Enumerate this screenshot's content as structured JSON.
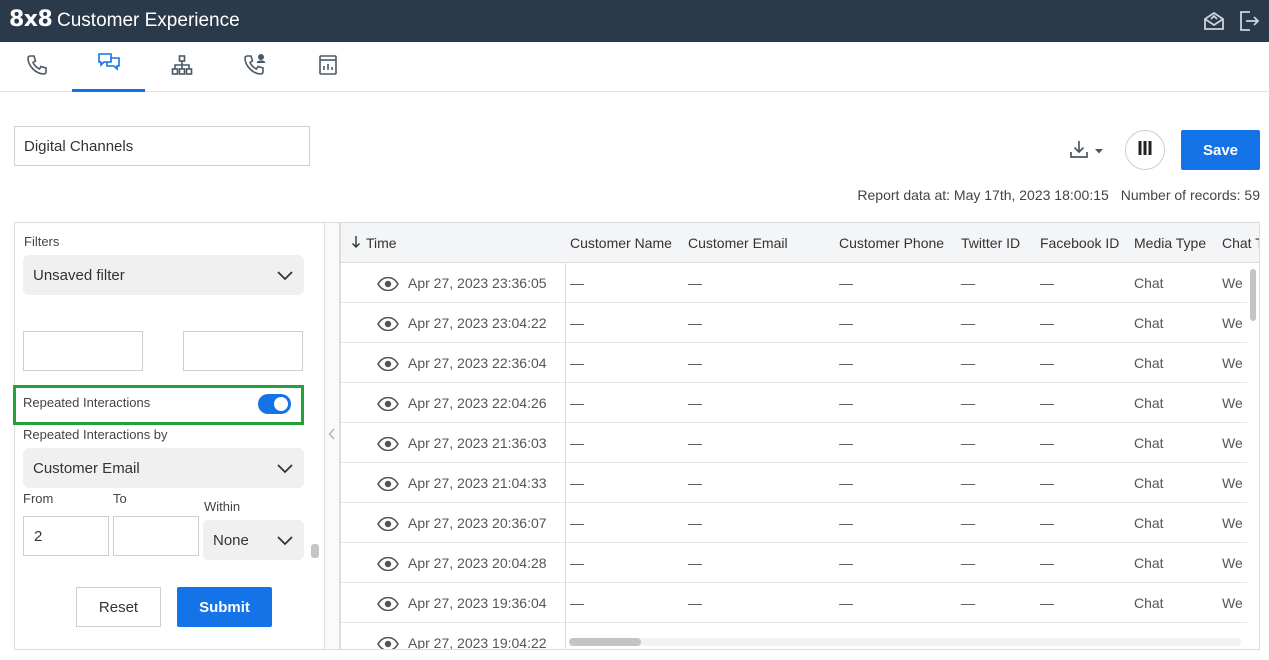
{
  "header": {
    "logo": "8x8",
    "title": "Customer Experience"
  },
  "tabs": [
    {
      "icon": "phone-icon",
      "active": false
    },
    {
      "icon": "chat-bubbles-icon",
      "active": true
    },
    {
      "icon": "org-chart-icon",
      "active": false
    },
    {
      "icon": "agent-call-icon",
      "active": false
    },
    {
      "icon": "report-icon",
      "active": false
    }
  ],
  "report": {
    "name": "Digital Channels",
    "save_label": "Save",
    "data_at": "Report data at: May 17th, 2023 18:00:15",
    "records": "Number of records: 59"
  },
  "filters": {
    "label": "Filters",
    "selected_filter": "Unsaved filter",
    "repeated_interactions_label": "Repeated Interactions",
    "repeated_interactions_enabled": true,
    "repeated_by_label": "Repeated Interactions by",
    "repeated_by_value": "Customer Email",
    "from_label": "From",
    "to_label": "To",
    "within_label": "Within",
    "from_value": "2",
    "to_value": "",
    "within_value": "None",
    "reset_label": "Reset",
    "submit_label": "Submit"
  },
  "table": {
    "columns": [
      "Time",
      "Customer Name",
      "Customer Email",
      "Customer Phone",
      "Twitter ID",
      "Facebook ID",
      "Media Type",
      "Chat T"
    ],
    "sort_column": "Time",
    "rows": [
      {
        "time": "Apr 27, 2023 23:36:05",
        "customer_name": "—",
        "customer_email": "—",
        "customer_phone": "—",
        "twitter_id": "—",
        "facebook_id": "—",
        "media_type": "Chat",
        "chat_type": "We"
      },
      {
        "time": "Apr 27, 2023 23:04:22",
        "customer_name": "—",
        "customer_email": "—",
        "customer_phone": "—",
        "twitter_id": "—",
        "facebook_id": "—",
        "media_type": "Chat",
        "chat_type": "We"
      },
      {
        "time": "Apr 27, 2023 22:36:04",
        "customer_name": "—",
        "customer_email": "—",
        "customer_phone": "—",
        "twitter_id": "—",
        "facebook_id": "—",
        "media_type": "Chat",
        "chat_type": "We"
      },
      {
        "time": "Apr 27, 2023 22:04:26",
        "customer_name": "—",
        "customer_email": "—",
        "customer_phone": "—",
        "twitter_id": "—",
        "facebook_id": "—",
        "media_type": "Chat",
        "chat_type": "We"
      },
      {
        "time": "Apr 27, 2023 21:36:03",
        "customer_name": "—",
        "customer_email": "—",
        "customer_phone": "—",
        "twitter_id": "—",
        "facebook_id": "—",
        "media_type": "Chat",
        "chat_type": "We"
      },
      {
        "time": "Apr 27, 2023 21:04:33",
        "customer_name": "—",
        "customer_email": "—",
        "customer_phone": "—",
        "twitter_id": "—",
        "facebook_id": "—",
        "media_type": "Chat",
        "chat_type": "We"
      },
      {
        "time": "Apr 27, 2023 20:36:07",
        "customer_name": "—",
        "customer_email": "—",
        "customer_phone": "—",
        "twitter_id": "—",
        "facebook_id": "—",
        "media_type": "Chat",
        "chat_type": "We"
      },
      {
        "time": "Apr 27, 2023 20:04:28",
        "customer_name": "—",
        "customer_email": "—",
        "customer_phone": "—",
        "twitter_id": "—",
        "facebook_id": "—",
        "media_type": "Chat",
        "chat_type": "We"
      },
      {
        "time": "Apr 27, 2023 19:36:04",
        "customer_name": "—",
        "customer_email": "—",
        "customer_phone": "—",
        "twitter_id": "—",
        "facebook_id": "—",
        "media_type": "Chat",
        "chat_type": "We"
      },
      {
        "time": "Apr 27, 2023 19:04:22",
        "customer_name": "",
        "customer_email": "",
        "customer_phone": "",
        "twitter_id": "",
        "facebook_id": "",
        "media_type": "",
        "chat_type": ""
      }
    ]
  },
  "colors": {
    "topbar": "#2b3a4a",
    "accent": "#1473e6",
    "highlight_box": "#22a238"
  }
}
